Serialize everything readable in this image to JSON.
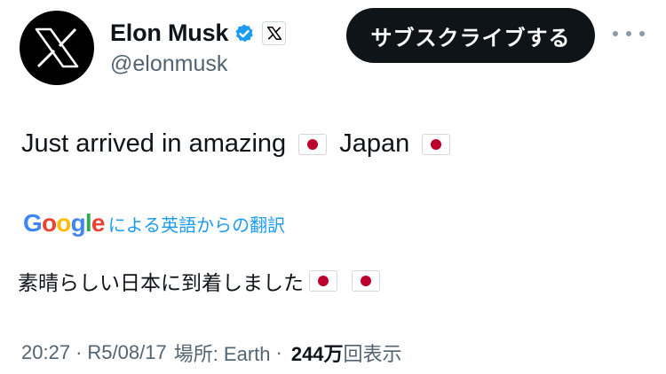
{
  "profile": {
    "name": "Elon Musk",
    "handle": "@elonmusk",
    "verified_color": "#1d9bf0",
    "avatar_icon": "x-logo-icon",
    "affiliation_icon": "x-logo-icon"
  },
  "actions": {
    "subscribe_label": "サブスクライブする",
    "more_icon": "more-horizontal-icon"
  },
  "tweet": {
    "text_part1": "Just arrived in amazing",
    "text_part2": "Japan",
    "flag_icon": "japan-flag-icon"
  },
  "translation": {
    "brand": "Google",
    "label": "による英語からの翻訳",
    "text": "素晴らしい日本に到着しました"
  },
  "meta": {
    "time": "20:27",
    "separator": "·",
    "date": "R5/08/17",
    "location": "場所: Earth",
    "views_count": "244万",
    "views_label": "回表示"
  }
}
